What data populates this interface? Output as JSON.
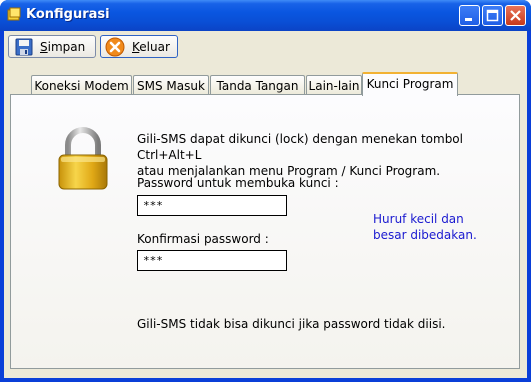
{
  "window": {
    "title": "Konfigurasi"
  },
  "toolbar": {
    "save_label_first": "S",
    "save_label_rest": "impan",
    "exit_label_first": "K",
    "exit_label_rest": "eluar"
  },
  "tabs": [
    {
      "label": "Koneksi Modem"
    },
    {
      "label": "SMS Masuk"
    },
    {
      "label": "Tanda Tangan"
    },
    {
      "label": "Lain-lain"
    },
    {
      "label": "Kunci Program"
    }
  ],
  "panel": {
    "intro_line1": "Gili-SMS dapat dikunci (lock) dengan menekan tombol Ctrl+Alt+L",
    "intro_line2": "atau menjalankan menu Program / Kunci Program.",
    "password_label": "Password untuk membuka kunci :",
    "password_value": "***",
    "confirm_label": "Konfirmasi password :",
    "confirm_value": "***",
    "note_line1": "Huruf kecil dan",
    "note_line2": "besar dibedakan.",
    "footer": "Gili-SMS tidak bisa dikunci jika password tidak diisi."
  },
  "icons": [
    "app-icon",
    "minimize-icon",
    "maximize-icon",
    "close-icon",
    "save-icon",
    "exit-icon",
    "padlock-icon"
  ],
  "colors": {
    "titlebar": "#0a56e0",
    "active_tab_accent": "#f2b233",
    "note_text": "#1a1ad0"
  }
}
